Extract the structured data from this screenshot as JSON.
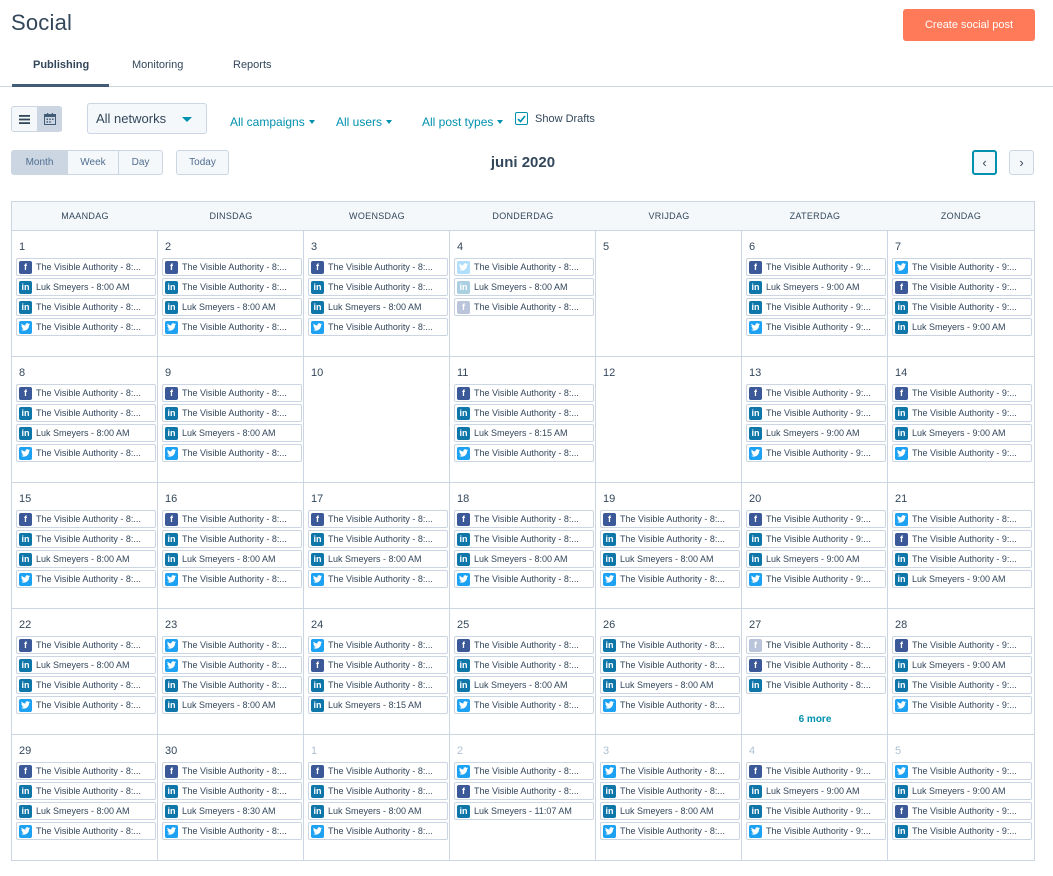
{
  "header": {
    "title": "Social",
    "create_button": "Create social post"
  },
  "tabs": [
    {
      "label": "Publishing",
      "active": true
    },
    {
      "label": "Monitoring",
      "active": false
    },
    {
      "label": "Reports",
      "active": false
    }
  ],
  "filters": {
    "network_select": "All networks",
    "campaigns": "All campaigns",
    "users": "All users",
    "post_types": "All post types",
    "show_drafts": "Show Drafts",
    "show_drafts_checked": true
  },
  "toolbar": {
    "range_buttons": [
      "Month",
      "Week",
      "Day"
    ],
    "active_range": "Month",
    "today": "Today",
    "month_label": "juni 2020"
  },
  "colors": {
    "accent": "#0091ae",
    "primary_button": "#ff7a59",
    "facebook": "#3b5998",
    "linkedin": "#0e76a8",
    "twitter": "#1da1f2"
  },
  "calendar": {
    "weekdays": [
      "MAANDAG",
      "DINSDAG",
      "WOENSDAG",
      "DONDERDAG",
      "VRIJDAG",
      "ZATERDAG",
      "ZONDAG"
    ],
    "weeks": [
      [
        {
          "day": "1",
          "posts": [
            [
              "facebook",
              "The Visible Authority - 8:..."
            ],
            [
              "linkedin",
              "Luk Smeyers - 8:00 AM"
            ],
            [
              "linkedin",
              "The Visible Authority - 8:..."
            ],
            [
              "twitter",
              "The Visible Authority - 8:..."
            ]
          ]
        },
        {
          "day": "2",
          "posts": [
            [
              "facebook",
              "The Visible Authority - 8:..."
            ],
            [
              "linkedin",
              "The Visible Authority - 8:..."
            ],
            [
              "linkedin",
              "Luk Smeyers - 8:00 AM"
            ],
            [
              "twitter",
              "The Visible Authority - 8:..."
            ]
          ]
        },
        {
          "day": "3",
          "posts": [
            [
              "facebook",
              "The Visible Authority - 8:..."
            ],
            [
              "linkedin",
              "The Visible Authority - 8:..."
            ],
            [
              "linkedin",
              "Luk Smeyers - 8:00 AM"
            ],
            [
              "twitter",
              "The Visible Authority - 8:..."
            ]
          ]
        },
        {
          "day": "4",
          "posts": [
            [
              "twitter-faded",
              "The Visible Authority - 8:..."
            ],
            [
              "linkedin-faded",
              "Luk Smeyers - 8:00 AM"
            ],
            [
              "facebook-faded",
              "The Visible Authority - 8:..."
            ]
          ]
        },
        {
          "day": "5",
          "posts": []
        },
        {
          "day": "6",
          "posts": [
            [
              "facebook",
              "The Visible Authority - 9:..."
            ],
            [
              "linkedin",
              "Luk Smeyers - 9:00 AM"
            ],
            [
              "linkedin",
              "The Visible Authority - 9:..."
            ],
            [
              "twitter",
              "The Visible Authority - 9:..."
            ]
          ]
        },
        {
          "day": "7",
          "posts": [
            [
              "twitter",
              "The Visible Authority - 9:..."
            ],
            [
              "facebook",
              "The Visible Authority - 9:..."
            ],
            [
              "linkedin",
              "The Visible Authority - 9:..."
            ],
            [
              "linkedin",
              "Luk Smeyers - 9:00 AM"
            ]
          ]
        }
      ],
      [
        {
          "day": "8",
          "posts": [
            [
              "facebook",
              "The Visible Authority - 8:..."
            ],
            [
              "linkedin",
              "The Visible Authority - 8:..."
            ],
            [
              "linkedin",
              "Luk Smeyers - 8:00 AM"
            ],
            [
              "twitter",
              "The Visible Authority - 8:..."
            ]
          ]
        },
        {
          "day": "9",
          "posts": [
            [
              "facebook",
              "The Visible Authority - 8:..."
            ],
            [
              "linkedin",
              "The Visible Authority - 8:..."
            ],
            [
              "linkedin",
              "Luk Smeyers - 8:00 AM"
            ],
            [
              "twitter",
              "The Visible Authority - 8:..."
            ]
          ]
        },
        {
          "day": "10",
          "posts": []
        },
        {
          "day": "11",
          "posts": [
            [
              "facebook",
              "The Visible Authority - 8:..."
            ],
            [
              "linkedin",
              "The Visible Authority - 8:..."
            ],
            [
              "linkedin",
              "Luk Smeyers - 8:15 AM"
            ],
            [
              "twitter",
              "The Visible Authority - 8:..."
            ]
          ]
        },
        {
          "day": "12",
          "posts": []
        },
        {
          "day": "13",
          "posts": [
            [
              "facebook",
              "The Visible Authority - 9:..."
            ],
            [
              "linkedin",
              "The Visible Authority - 9:..."
            ],
            [
              "linkedin",
              "Luk Smeyers - 9:00 AM"
            ],
            [
              "twitter",
              "The Visible Authority - 9:..."
            ]
          ]
        },
        {
          "day": "14",
          "posts": [
            [
              "facebook",
              "The Visible Authority - 9:..."
            ],
            [
              "linkedin",
              "The Visible Authority - 9:..."
            ],
            [
              "linkedin",
              "Luk Smeyers - 9:00 AM"
            ],
            [
              "twitter",
              "The Visible Authority - 9:..."
            ]
          ]
        }
      ],
      [
        {
          "day": "15",
          "posts": [
            [
              "facebook",
              "The Visible Authority - 8:..."
            ],
            [
              "linkedin",
              "The Visible Authority - 8:..."
            ],
            [
              "linkedin",
              "Luk Smeyers - 8:00 AM"
            ],
            [
              "twitter",
              "The Visible Authority - 8:..."
            ]
          ]
        },
        {
          "day": "16",
          "posts": [
            [
              "facebook",
              "The Visible Authority - 8:..."
            ],
            [
              "linkedin",
              "The Visible Authority - 8:..."
            ],
            [
              "linkedin",
              "Luk Smeyers - 8:00 AM"
            ],
            [
              "twitter",
              "The Visible Authority - 8:..."
            ]
          ]
        },
        {
          "day": "17",
          "posts": [
            [
              "facebook",
              "The Visible Authority - 8:..."
            ],
            [
              "linkedin",
              "The Visible Authority - 8:..."
            ],
            [
              "linkedin",
              "Luk Smeyers - 8:00 AM"
            ],
            [
              "twitter",
              "The Visible Authority - 8:..."
            ]
          ]
        },
        {
          "day": "18",
          "posts": [
            [
              "facebook",
              "The Visible Authority - 8:..."
            ],
            [
              "linkedin",
              "The Visible Authority - 8:..."
            ],
            [
              "linkedin",
              "Luk Smeyers - 8:00 AM"
            ],
            [
              "twitter",
              "The Visible Authority - 8:..."
            ]
          ]
        },
        {
          "day": "19",
          "posts": [
            [
              "facebook",
              "The Visible Authority - 8:..."
            ],
            [
              "linkedin",
              "The Visible Authority - 8:..."
            ],
            [
              "linkedin",
              "Luk Smeyers - 8:00 AM"
            ],
            [
              "twitter",
              "The Visible Authority - 8:..."
            ]
          ]
        },
        {
          "day": "20",
          "posts": [
            [
              "facebook",
              "The Visible Authority - 9:..."
            ],
            [
              "linkedin",
              "The Visible Authority - 9:..."
            ],
            [
              "linkedin",
              "Luk Smeyers - 9:00 AM"
            ],
            [
              "twitter",
              "The Visible Authority - 9:..."
            ]
          ]
        },
        {
          "day": "21",
          "posts": [
            [
              "twitter",
              "The Visible Authority - 8:..."
            ],
            [
              "facebook",
              "The Visible Authority - 9:..."
            ],
            [
              "linkedin",
              "The Visible Authority - 9:..."
            ],
            [
              "linkedin",
              "Luk Smeyers - 9:00 AM"
            ]
          ]
        }
      ],
      [
        {
          "day": "22",
          "posts": [
            [
              "facebook",
              "The Visible Authority - 8:..."
            ],
            [
              "linkedin",
              "Luk Smeyers - 8:00 AM"
            ],
            [
              "linkedin",
              "The Visible Authority - 8:..."
            ],
            [
              "twitter",
              "The Visible Authority - 8:..."
            ]
          ]
        },
        {
          "day": "23",
          "posts": [
            [
              "twitter",
              "The Visible Authority - 8:..."
            ],
            [
              "twitter",
              "The Visible Authority - 8:..."
            ],
            [
              "linkedin",
              "The Visible Authority - 8:..."
            ],
            [
              "linkedin",
              "Luk Smeyers - 8:00 AM"
            ]
          ]
        },
        {
          "day": "24",
          "posts": [
            [
              "twitter",
              "The Visible Authority - 8:..."
            ],
            [
              "facebook",
              "The Visible Authority - 8:..."
            ],
            [
              "linkedin",
              "The Visible Authority - 8:..."
            ],
            [
              "linkedin",
              "Luk Smeyers - 8:15 AM"
            ]
          ]
        },
        {
          "day": "25",
          "posts": [
            [
              "facebook",
              "The Visible Authority - 8:..."
            ],
            [
              "linkedin",
              "The Visible Authority - 8:..."
            ],
            [
              "linkedin",
              "Luk Smeyers - 8:00 AM"
            ],
            [
              "twitter",
              "The Visible Authority - 8:..."
            ]
          ]
        },
        {
          "day": "26",
          "posts": [
            [
              "linkedin",
              "The Visible Authority - 8:..."
            ],
            [
              "linkedin",
              "The Visible Authority - 8:..."
            ],
            [
              "linkedin",
              "Luk Smeyers - 8:00 AM"
            ],
            [
              "twitter",
              "The Visible Authority - 8:..."
            ]
          ]
        },
        {
          "day": "27",
          "posts": [
            [
              "facebook-faded",
              "The Visible Authority - 8:..."
            ],
            [
              "facebook",
              "The Visible Authority - 8:..."
            ],
            [
              "linkedin",
              "The Visible Authority - 8:..."
            ]
          ],
          "more": "6 more"
        },
        {
          "day": "28",
          "posts": [
            [
              "facebook",
              "The Visible Authority - 9:..."
            ],
            [
              "linkedin",
              "Luk Smeyers - 9:00 AM"
            ],
            [
              "linkedin",
              "The Visible Authority - 9:..."
            ],
            [
              "twitter",
              "The Visible Authority - 9:..."
            ]
          ]
        }
      ],
      [
        {
          "day": "29",
          "posts": [
            [
              "facebook",
              "The Visible Authority - 8:..."
            ],
            [
              "linkedin",
              "The Visible Authority - 8:..."
            ],
            [
              "linkedin",
              "Luk Smeyers - 8:00 AM"
            ],
            [
              "twitter",
              "The Visible Authority - 8:..."
            ]
          ]
        },
        {
          "day": "30",
          "posts": [
            [
              "facebook",
              "The Visible Authority - 8:..."
            ],
            [
              "linkedin",
              "The Visible Authority - 8:..."
            ],
            [
              "linkedin",
              "Luk Smeyers - 8:30 AM"
            ],
            [
              "twitter",
              "The Visible Authority - 8:..."
            ]
          ]
        },
        {
          "day": "1",
          "muted": true,
          "posts": [
            [
              "facebook",
              "The Visible Authority - 8:..."
            ],
            [
              "linkedin",
              "The Visible Authority - 8:..."
            ],
            [
              "linkedin",
              "Luk Smeyers - 8:00 AM"
            ],
            [
              "twitter",
              "The Visible Authority - 8:..."
            ]
          ]
        },
        {
          "day": "2",
          "muted": true,
          "posts": [
            [
              "twitter",
              "The Visible Authority - 8:..."
            ],
            [
              "facebook",
              "The Visible Authority - 8:..."
            ],
            [
              "linkedin",
              "Luk Smeyers - 11:07 AM"
            ]
          ]
        },
        {
          "day": "3",
          "muted": true,
          "posts": [
            [
              "twitter",
              "The Visible Authority - 8:..."
            ],
            [
              "linkedin",
              "The Visible Authority - 8:..."
            ],
            [
              "linkedin",
              "Luk Smeyers - 8:00 AM"
            ],
            [
              "twitter",
              "The Visible Authority - 8:..."
            ]
          ]
        },
        {
          "day": "4",
          "muted": true,
          "posts": [
            [
              "facebook",
              "The Visible Authority - 9:..."
            ],
            [
              "linkedin",
              "Luk Smeyers - 9:00 AM"
            ],
            [
              "linkedin",
              "The Visible Authority - 9:..."
            ],
            [
              "twitter",
              "The Visible Authority - 9:..."
            ]
          ]
        },
        {
          "day": "5",
          "muted": true,
          "posts": [
            [
              "twitter",
              "The Visible Authority - 9:..."
            ],
            [
              "linkedin",
              "Luk Smeyers - 9:00 AM"
            ],
            [
              "facebook",
              "The Visible Authority - 9:..."
            ],
            [
              "linkedin",
              "The Visible Authority - 9:..."
            ]
          ]
        }
      ]
    ]
  }
}
